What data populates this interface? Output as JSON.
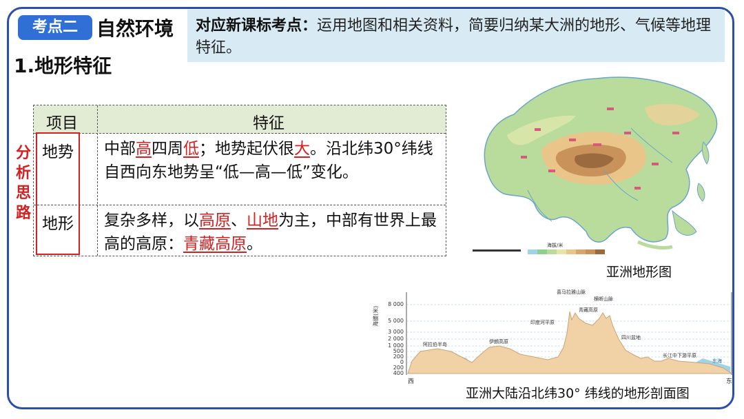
{
  "header": {
    "tag": "考点二",
    "section_title": "自然环境",
    "subtitle": "1.地形特征"
  },
  "standard": {
    "lead": "对应新课标考点：",
    "text": "运用地图和相关资料，简要归纳某大洲的地形、气候等地理特征。"
  },
  "table": {
    "headers": [
      "项目",
      "特征"
    ],
    "rows": [
      {
        "label": "地势",
        "parts": [
          "中部",
          "高",
          "四周",
          "低",
          "；地势起伏很",
          "大",
          "。沿北纬30°纬线自西向东地势呈“低—高—低”变化。"
        ]
      },
      {
        "label": "地形",
        "parts": [
          "复杂多样，以",
          "高原",
          "、",
          "山地",
          "为主，中部有世界上最高的高原：",
          "青藏高原",
          "。"
        ]
      }
    ]
  },
  "side_note": [
    "分",
    "析",
    "思",
    "路"
  ],
  "map": {
    "caption": "亚洲地形图",
    "legend_title": "海拔/米",
    "legend_values": [
      "0",
      "200",
      "500",
      "1000",
      "2000",
      "3000",
      "4000",
      "5000",
      "6000"
    ]
  },
  "profile": {
    "caption": "亚洲大陆沿北纬30° 纬线的地形剖面图",
    "axis_label": "海拔(米)",
    "y_ticks": [
      "8 000",
      "5 000",
      "3 000",
      "2 000",
      "1 000",
      "500",
      "200",
      "0",
      "200",
      "400"
    ],
    "x_labels": [
      "西",
      "东"
    ],
    "annotations": [
      "阿拉伯半岛",
      "伊朗高原",
      "印度河平原",
      "青藏高原",
      "喜马拉雅山脉",
      "横断山脉",
      "四川盆地",
      "长江中下游平原",
      "东海"
    ],
    "colors": {
      "land": "#f0d2a6",
      "sea": "#9fd3e8"
    }
  }
}
